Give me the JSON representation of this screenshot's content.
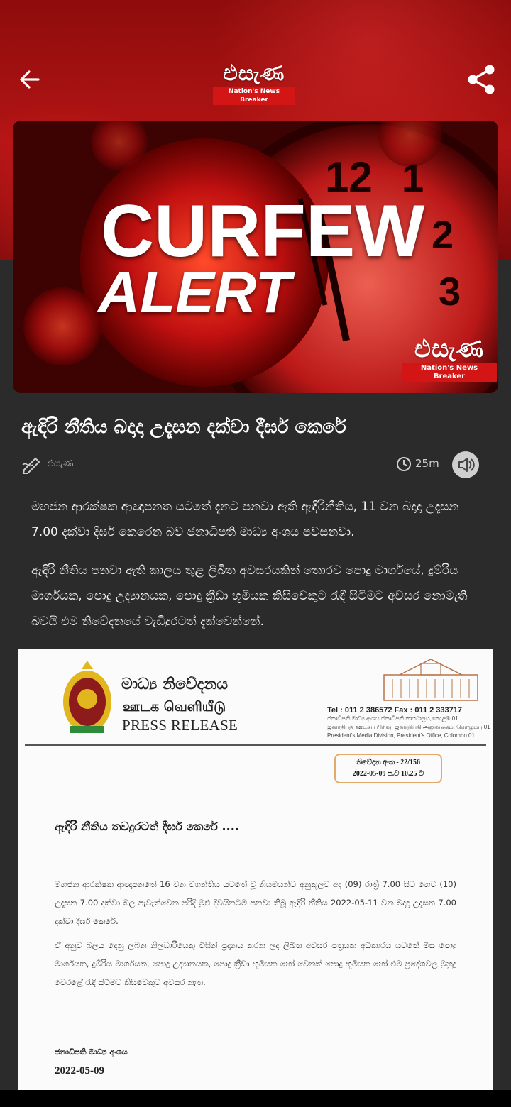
{
  "header": {
    "logo_text": "එසැණ",
    "logo_tagline": "Nation's News Breaker",
    "back_icon": "arrow-left-icon",
    "share_icon": "share-icon"
  },
  "banner": {
    "line1": "CURFEW",
    "line2": "ALERT",
    "logo_text": "එසැණ",
    "logo_tagline": "Nation's News Breaker"
  },
  "article": {
    "headline": "ඇඳිරි නීතිය බදාදා උදෑසන දක්වා දීර්ඝ කෙරේ",
    "author": "එසැණ",
    "time_ago": "25m",
    "paragraphs": [
      "මහජන ආරක්ෂක ආඥාපනත යටතේ දැනට පනවා ඇති ඇඳිරිනීතිය, 11 වන බදාදා උදෑසන 7.00 දක්වා දීර්ඝ කෙරෙන බව ජනාධිපති මාධ්‍ය අංශය පවසනවා.",
      "ඇඳිරි නීතිය පනවා ඇති කාලය තුළ ලිඛිත අවසරයකින් තොරව පොදු මාර්ගයේ, දුම්රිය මාර්ගයක, පොදු උද්‍යානයක, පොදු ක්‍රීඩා භූමියක කිසිවෙකුට රැඳී සිටීමට අවසර නොමැති බවයි එම නිවේදනයේ වැඩිදුරටත් දැක්වෙන්නේ."
    ]
  },
  "press_release": {
    "title_si": "මාධ්‍ය නිවේදනය",
    "title_ta": "ஊடக வெளியீடு",
    "title_en": "PRESS RELEASE",
    "tel": "Tel   : 011 2 386572      Fax  : 011 2 333717",
    "address_si": "ජනාධිපති මාධ්‍ය අංශය,ජනාධිපති කාර්යාලය,කොළඹ 01",
    "address_ta": "ஜனாதிபதி ஊடகப் பிரிவு, ஜனாதிபதி அலுவலகம், கொழும்பு 01",
    "address_en": "President's Media Division, President's Office, Colombo 01",
    "ref_no": "නිවේදන අංක - 22/156",
    "ref_date": "2022-05-09  ප.ව 10.25 ට",
    "heading": "ඇඳිරි නීතිය තවදුරටත් දීර්ඝ කෙරේ ....",
    "para1": "මහජන ආරක්ෂක ආඥාපනතේ 16 වන වගන්තිය යටතේ වූ නියමයන්ට අනුකූලව අද (09) රාත්‍රී 7.00 සිට හෙට (10) උදෑසන 7.00 දක්වා බල පැවැත්වෙන පරිදි මුළු දිවයිනටම පනවා තිබූ ඇඳිරි නීතිය  2022-05-11 වන බදාදා උදෑසන 7.00 දක්වා දීර්ඝ කෙරේ.",
    "para2": "ඒ අනුව බලය දෙනු ලබන නිලධාරියෙකු විසින් ප්‍රදානය කරන ලද ලිඛිත අවසර පත්‍රයක අධිකාරය යටතේ මිස පොදු මාර්ගයක, දුම්රිය මාර්ගයක, පොදු උද්‍යානයක, පොදු ක්‍රීඩා භූමියක හෝ වෙනත් පොදු භූමියක හෝ එම ප්‍රදේශවල මුහුදු වෙරළේ රැඳී සිටීමට කිසිවෙකුට අවසර නැත.",
    "signature": "ජනාධිපති මාධ්‍ය අංශය",
    "date": "2022-05-09"
  },
  "colors": {
    "header_red": "#b31414",
    "page_bg": "#2b2b2b",
    "text_white": "#ffffff"
  }
}
